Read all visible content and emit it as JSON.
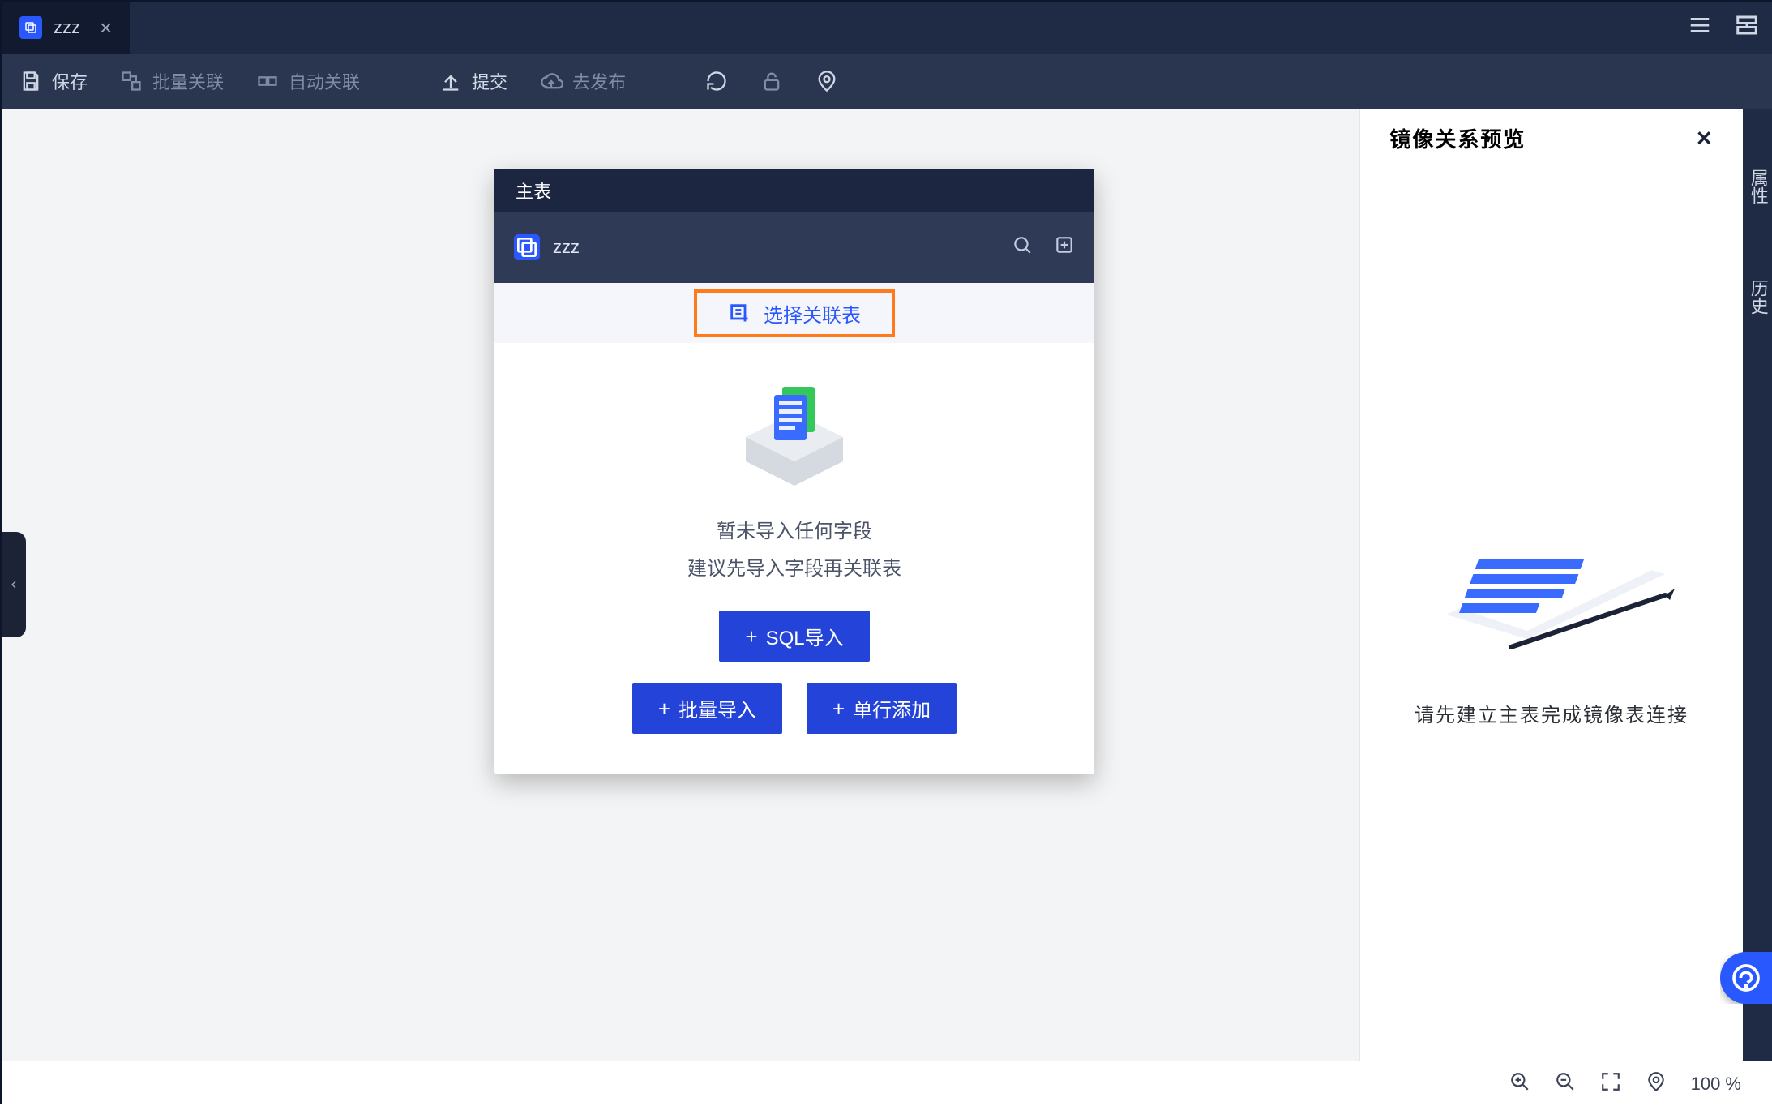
{
  "tab": {
    "title": "zzz"
  },
  "toolbar": {
    "save": "保存",
    "batch_link": "批量关联",
    "auto_link": "自动关联",
    "submit": "提交",
    "publish": "去发布"
  },
  "card": {
    "header": "主表",
    "name": "zzz",
    "select_link_table": "选择关联表",
    "empty_line1": "暂未导入任何字段",
    "empty_line2": "建议先导入字段再关联表",
    "sql_import": "SQL导入",
    "batch_import": "批量导入",
    "add_row": "单行添加"
  },
  "preview": {
    "title": "镜像关系预览",
    "msg": "请先建立主表完成镜像表连接"
  },
  "sidebar": {
    "attr": "属性",
    "history": "历史"
  },
  "statusbar": {
    "zoom": "100 %"
  }
}
